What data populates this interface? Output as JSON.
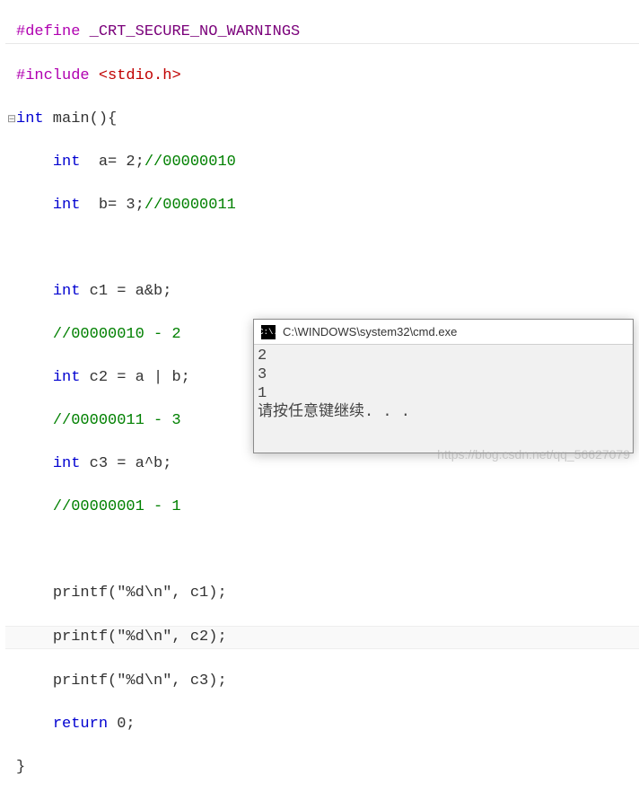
{
  "code": {
    "l1_define": "#define",
    "l1_macro": " _CRT_SECURE_NO_WARNINGS",
    "l2_include": "#include",
    "l2_header": " <stdio.h>",
    "gutter_collapse": "⊟",
    "l3_kw": "int",
    "l3_rest": " main(){",
    "indent1": "    ",
    "l4_kw": "int",
    "l4_mid": "  a= 2;",
    "l4_cmt": "//00000010",
    "l5_kw": "int",
    "l5_mid": "  b= 3;",
    "l5_cmt": "//00000011",
    "blank": "",
    "l7_kw": "int",
    "l7_mid": " c1 = a&b;",
    "l8_cmt": "//00000010 - 2",
    "l9_kw": "int",
    "l9_mid": " c2 = a | b;",
    "l10_cmt": "//00000011 - 3",
    "l11_kw": "int",
    "l11_mid": " c3 = a^b;",
    "l12_cmt": "//00000001 - 1",
    "l14": "printf(\"%d\\n\", c1);",
    "l15": "printf(\"%d\\n\", c2);",
    "l16": "printf(\"%d\\n\", c3);",
    "l17_kw": "return",
    "l17_rest": " 0;",
    "l18": "}"
  },
  "cmd": {
    "icon_text": "C:\\.",
    "title": "C:\\WINDOWS\\system32\\cmd.exe",
    "out1": "2",
    "out2": "3",
    "out3": "1",
    "prompt": "请按任意键继续. . ."
  },
  "watermark": "https://blog.csdn.net/qq_56627079"
}
